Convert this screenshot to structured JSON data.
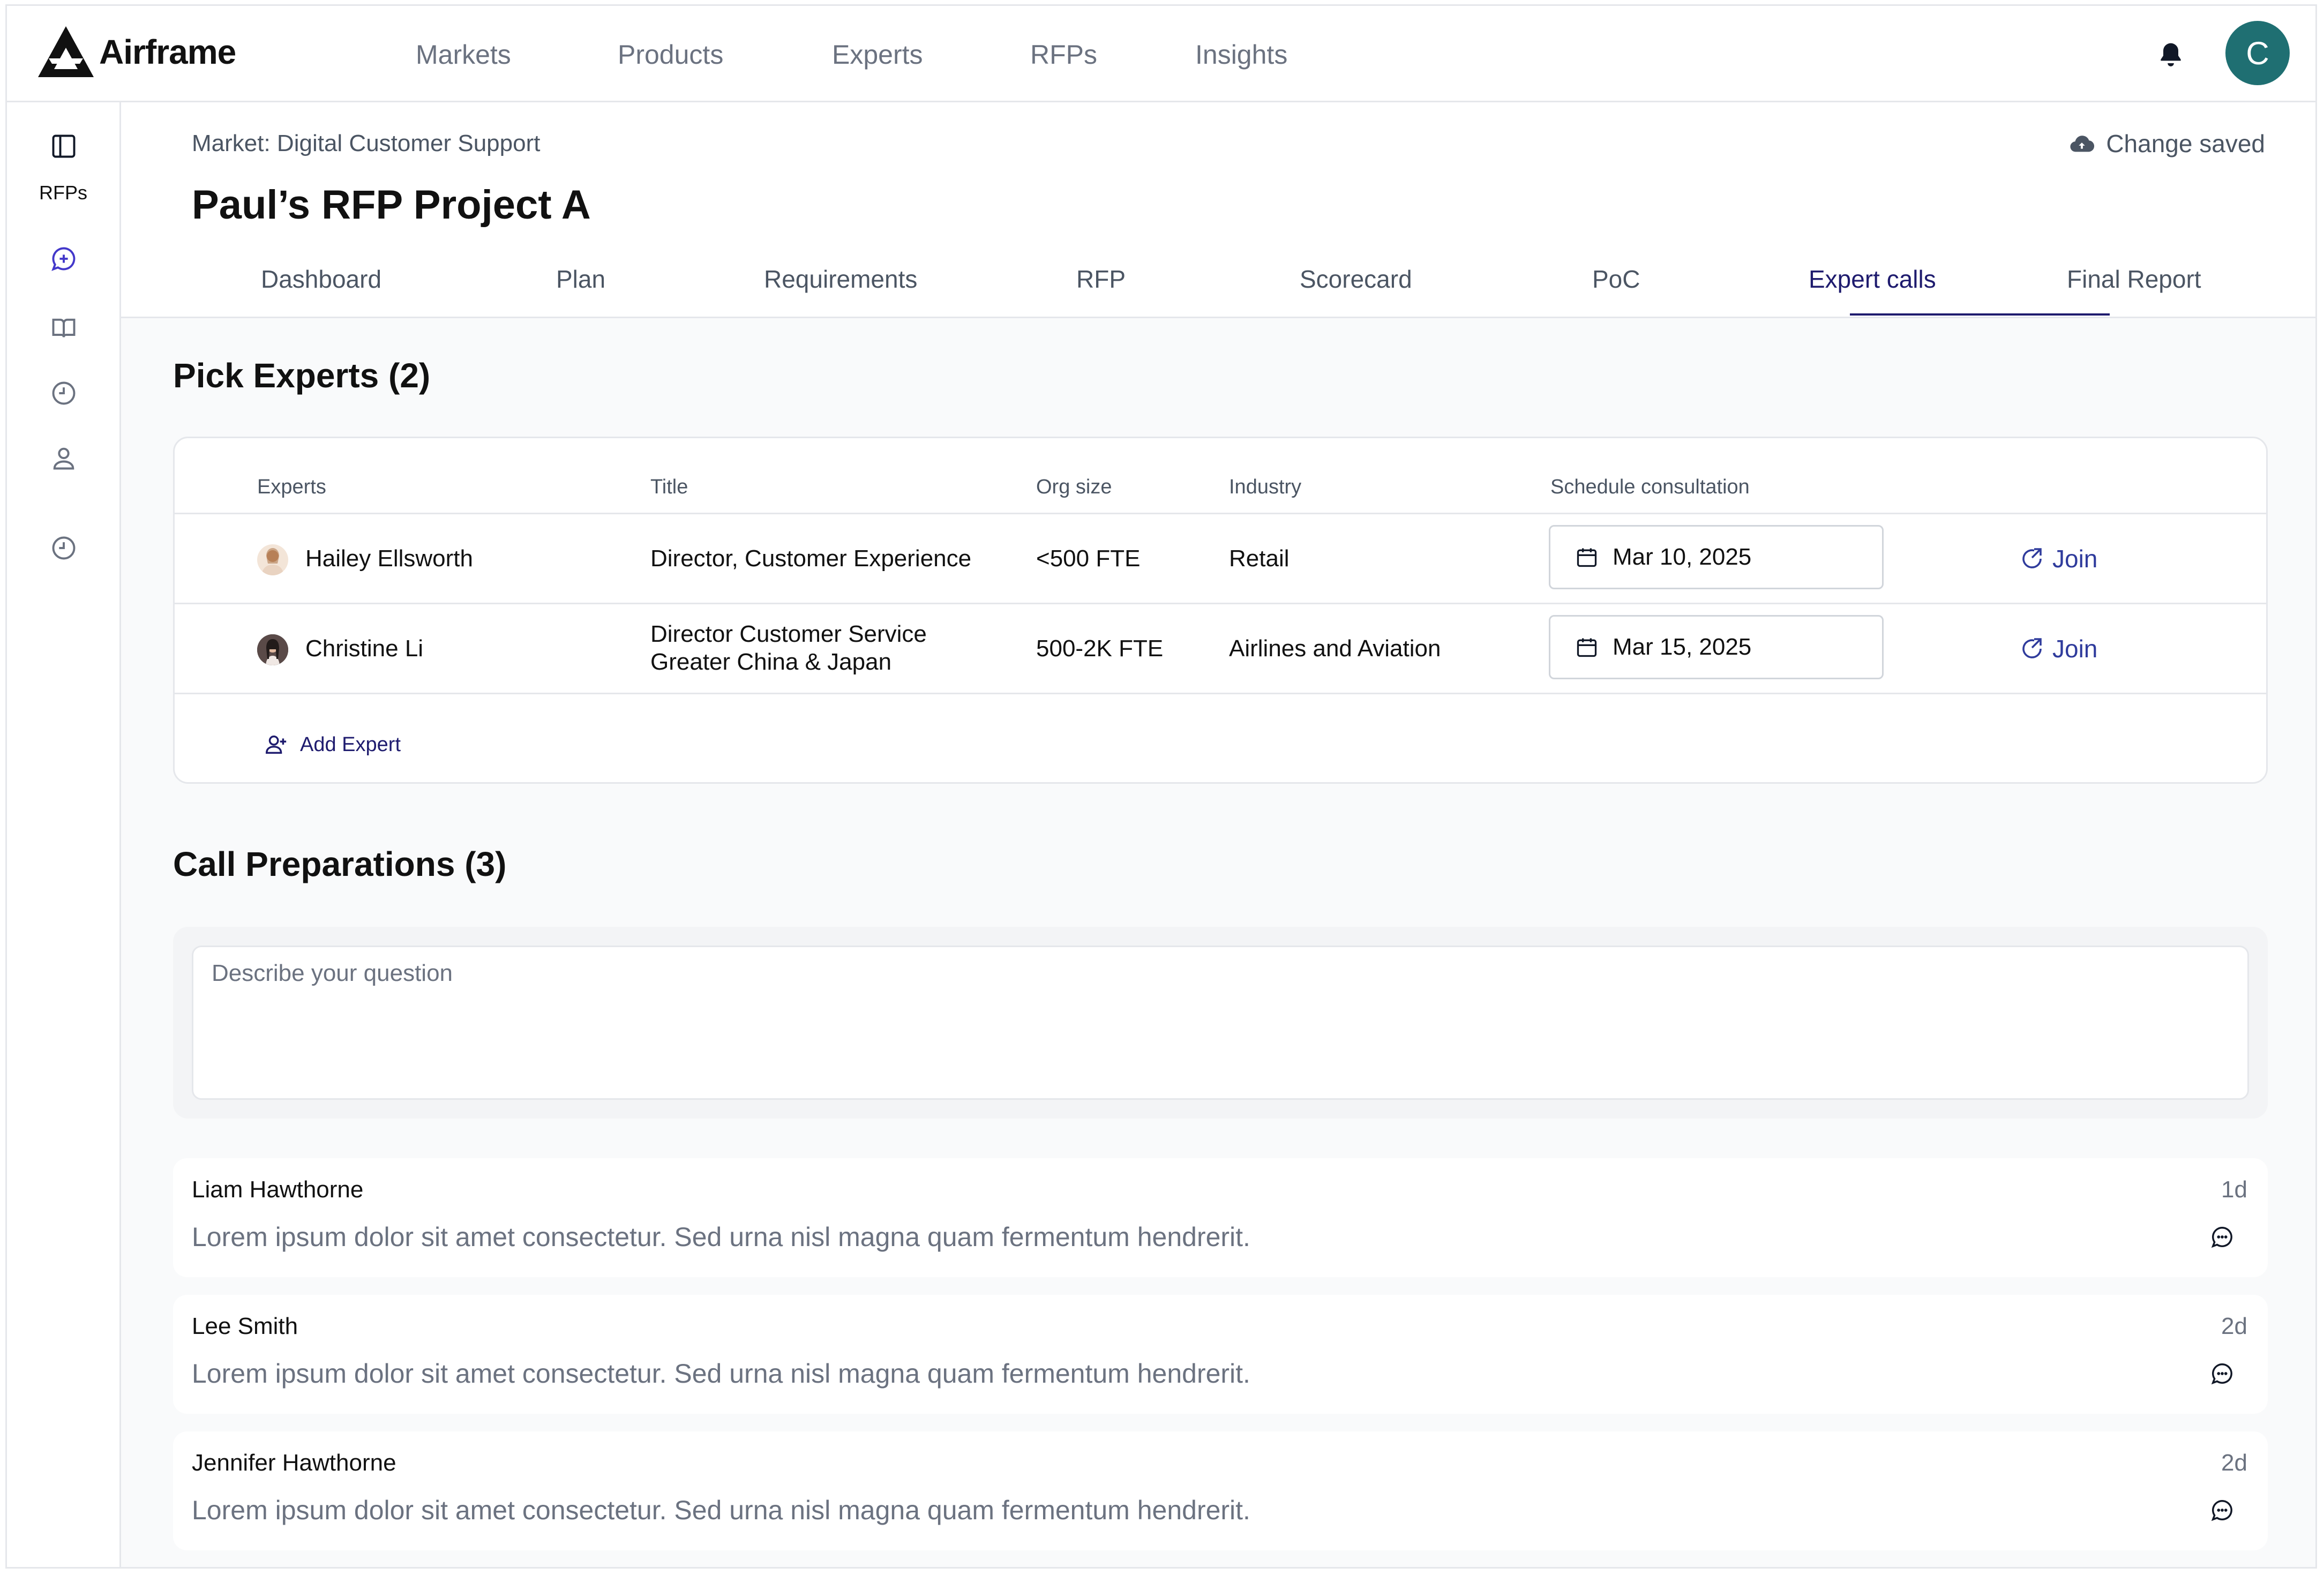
{
  "app": {
    "name": "Airframe"
  },
  "nav": {
    "items": [
      "Markets",
      "Products",
      "Experts",
      "RFPs",
      "Insights"
    ]
  },
  "user": {
    "initial": "C",
    "avatar_color": "#1f6f72"
  },
  "sidebar": {
    "label": "RFPs"
  },
  "header": {
    "breadcrumb": "Market: Digital Customer Support",
    "saved_status": "Change saved",
    "title": "Paul’s RFP Project A",
    "tabs": [
      "Dashboard",
      "Plan",
      "Requirements",
      "RFP",
      "Scorecard",
      "PoC",
      "Expert calls",
      "Final Report"
    ],
    "active_tab": "Expert calls"
  },
  "experts": {
    "title": "Pick Experts (2)",
    "columns": [
      "Experts",
      "Title",
      "Org size",
      "Industry",
      "Schedule consultation"
    ],
    "rows": [
      {
        "name": "Hailey Ellsworth",
        "title": "Director, Customer Experience",
        "org_size": "<500 FTE",
        "industry": "Retail",
        "date": "Mar 10, 2025",
        "action": "Join"
      },
      {
        "name": "Christine Li",
        "title_line1": "Director Customer Service",
        "title_line2": "Greater China & Japan",
        "org_size": "500-2K FTE",
        "industry": "Airlines and Aviation",
        "date": "Mar 15, 2025",
        "action": "Join"
      }
    ],
    "add_label": "Add Expert"
  },
  "calls": {
    "title": "Call Preparations (3)",
    "input_placeholder": "Describe your question",
    "comments": [
      {
        "name": "Liam Hawthorne",
        "time": "1d",
        "text": "Lorem ipsum dolor sit amet consectetur. Sed urna nisl magna quam fermentum hendrerit."
      },
      {
        "name": "Lee Smith",
        "time": "2d",
        "text": "Lorem ipsum dolor sit amet consectetur. Sed urna nisl magna quam fermentum hendrerit."
      },
      {
        "name": "Jennifer Hawthorne",
        "time": "2d",
        "text": "Lorem ipsum dolor sit amet consectetur. Sed urna nisl magna quam fermentum hendrerit."
      }
    ]
  },
  "colors": {
    "accent": "#1e1b6e",
    "link": "#2f3b9c",
    "border": "#e5e7eb",
    "background": "#f9fafb"
  }
}
